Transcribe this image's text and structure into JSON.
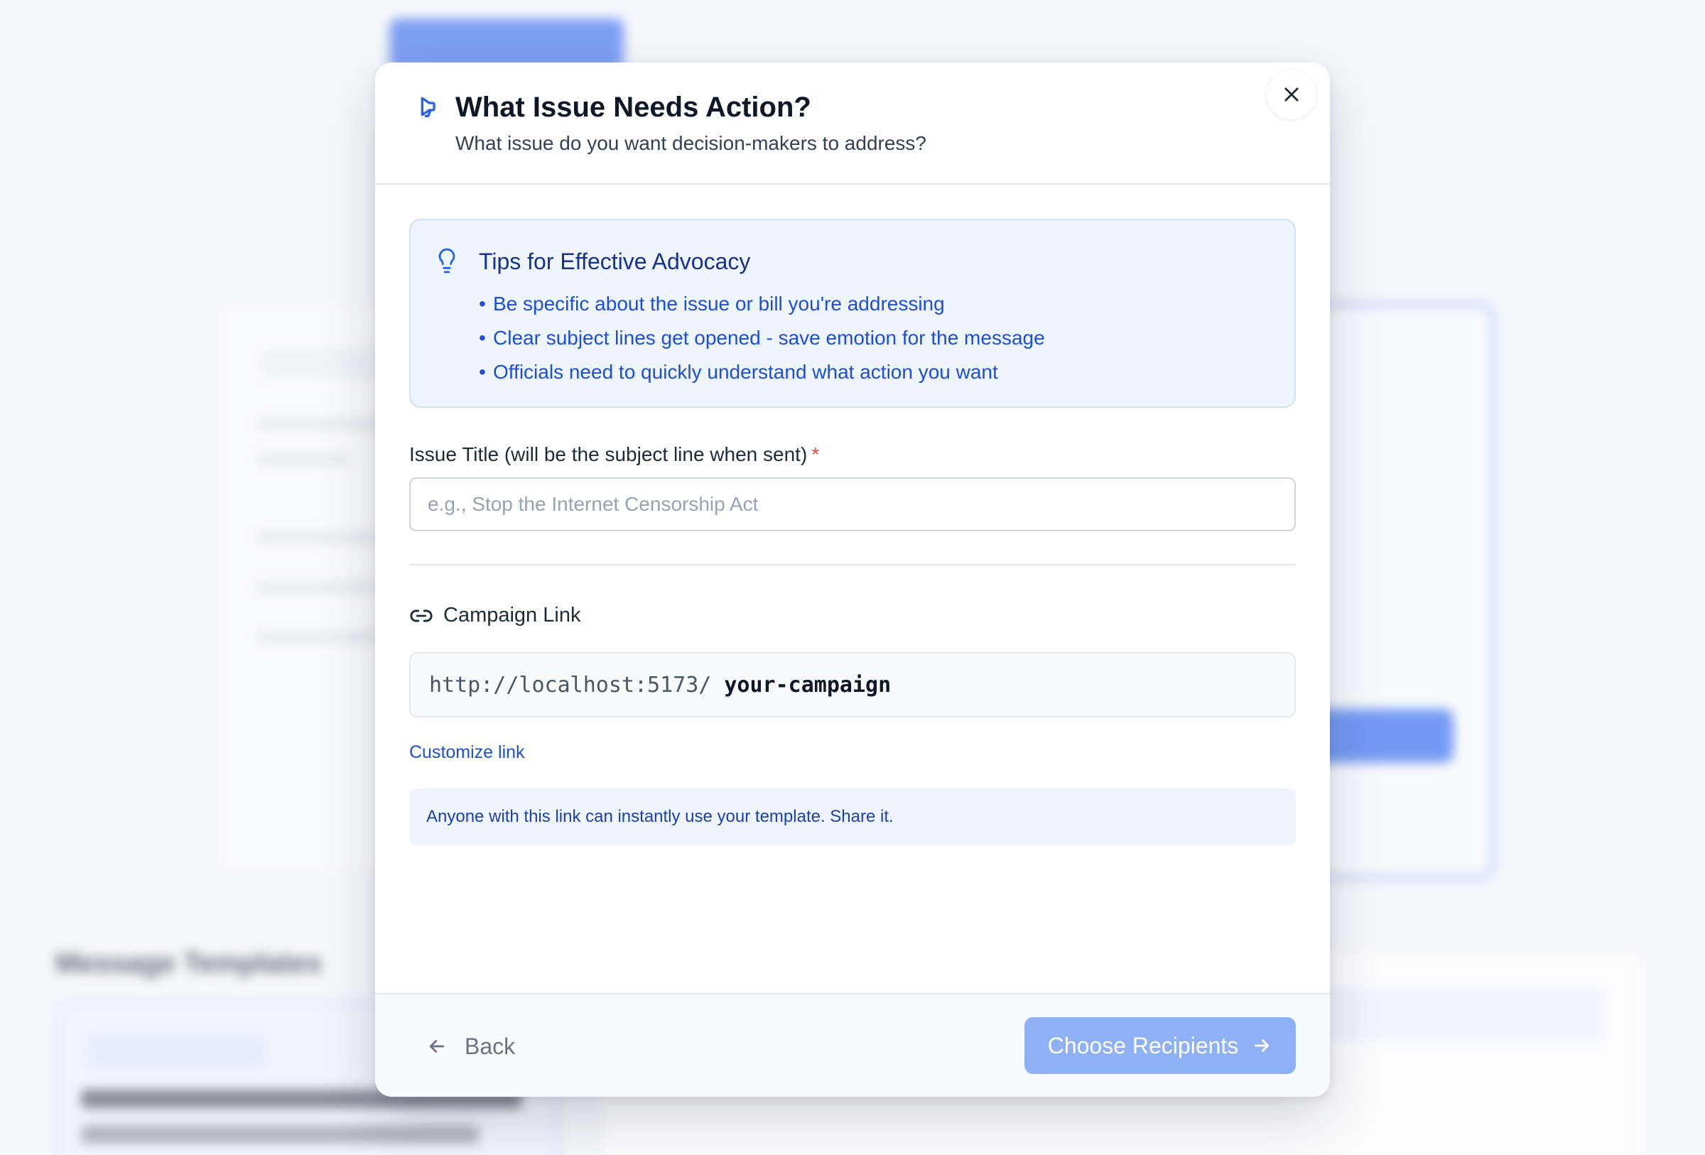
{
  "modal": {
    "title": "What Issue Needs Action?",
    "subtitle": "What issue do you want decision-makers to address?",
    "header_icon": "megaphone-icon",
    "close_icon": "close-icon"
  },
  "tips": {
    "title": "Tips for Effective Advocacy",
    "icon": "lightbulb-icon",
    "items": [
      "Be specific about the issue or bill you're addressing",
      "Clear subject lines get opened - save emotion for the message",
      "Officials need to quickly understand what action you want"
    ]
  },
  "issue_title": {
    "label": "Issue Title (will be the subject line when sent)",
    "required_marker": "*",
    "placeholder": "e.g., Stop the Internet Censorship Act",
    "value": ""
  },
  "campaign_link": {
    "label": "Campaign Link",
    "icon": "link-icon",
    "base_url": "http://localhost:5173/",
    "slug": "your-campaign",
    "customize_label": "Customize link",
    "note": "Anyone with this link can instantly use your template. Share it."
  },
  "footer": {
    "back_label": "Back",
    "next_label": "Choose Recipients"
  },
  "background": {
    "section_title": "Message Templates"
  },
  "colors": {
    "accent": "#2563eb",
    "primary_button_disabled": "#8eb0f5",
    "tips_background": "#eef5fe",
    "required": "#ef4444"
  }
}
